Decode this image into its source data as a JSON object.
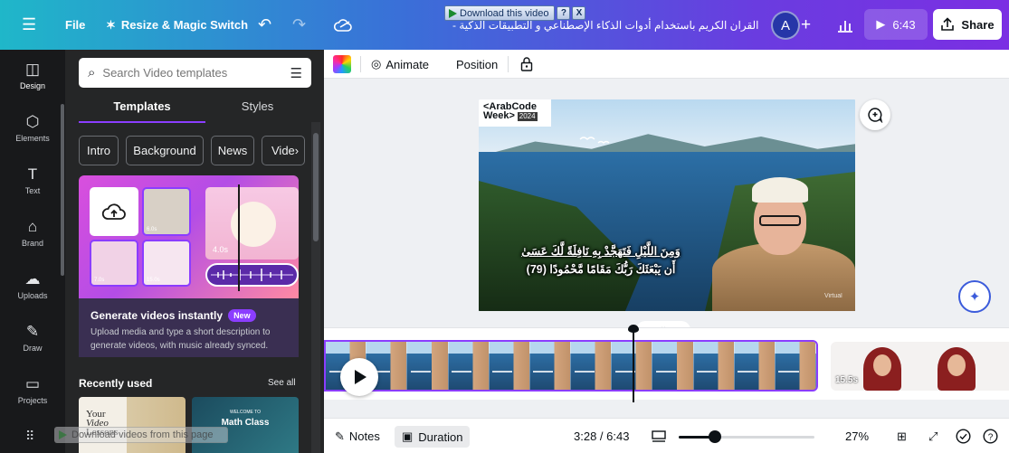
{
  "topbar": {
    "menu_icon": "hamburger-menu-icon",
    "file_label": "File",
    "resize_label": "Resize & Magic Switch",
    "doc_title": "... القران الكريم باستخدام أدوات الذكاء الإصطناعي و التطبيقات الذكية -",
    "avatar_initial": "A",
    "present_time": "6:43",
    "share_label": "Share",
    "gradient_start": "#1fb7c9",
    "gradient_end": "#7b2fe3"
  },
  "download_bar": {
    "label": "Download this video",
    "help": "?",
    "close": "X"
  },
  "rail": {
    "items": [
      {
        "label": "Design",
        "icon": "layout-icon"
      },
      {
        "label": "Elements",
        "icon": "shapes-icon"
      },
      {
        "label": "Text",
        "icon": "text-icon"
      },
      {
        "label": "Brand",
        "icon": "brand-icon"
      },
      {
        "label": "Uploads",
        "icon": "cloud-upload-icon"
      },
      {
        "label": "Draw",
        "icon": "pen-icon"
      },
      {
        "label": "Projects",
        "icon": "folder-icon"
      }
    ]
  },
  "panel": {
    "search_placeholder": "Search Video templates",
    "tabs": [
      "Templates",
      "Styles"
    ],
    "chips": [
      "Intro",
      "Background",
      "News",
      "Vide"
    ],
    "promo": {
      "title": "Generate videos instantly",
      "badge": "New",
      "description": "Upload media and type a short description to generate videos, with music already synced.",
      "time_label": "4.0s",
      "small_label_1": "6.0s",
      "small_label_2": "7.0s",
      "small_label_3": "15.0s"
    },
    "recent_title": "Recently used",
    "see_all": "See all",
    "recent_items": [
      {
        "line1": "Your",
        "line2": "Video",
        "line3": "Lessons"
      },
      {
        "line1": "WELCOME TO",
        "line2": "Math Class"
      }
    ]
  },
  "toolbar": {
    "animate_label": "Animate",
    "position_label": "Position"
  },
  "slide": {
    "logo_line1": "<ArabCode",
    "logo_line2": "Week>",
    "logo_year": "2024",
    "caption_line1": "وَمِنَ اللَّيْلِ فَتَهَجَّدْ بِهِ نَافِلَةً لَّكَ عَسَىٰ",
    "caption_line2": "أَن يَبْعَثَكَ رَبُّكَ مَقَامًا مَّحْمُودًا (79)",
    "watermark": "Virtual"
  },
  "timeline": {
    "second_clip_duration": "15.5s",
    "accent": "#8b3dff"
  },
  "footer": {
    "notes_label": "Notes",
    "duration_label": "Duration",
    "time_display": "3:28 / 6:43",
    "zoom_percent": "27%",
    "zoom_level": 0.27
  },
  "overlay": {
    "text": "Download videos from this page"
  }
}
